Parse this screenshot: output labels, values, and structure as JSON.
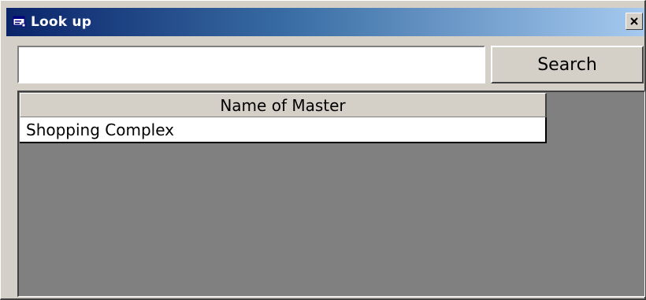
{
  "window": {
    "title": "Look up",
    "title_icon": "window-app-icon",
    "close_label": "×"
  },
  "search": {
    "value": "",
    "placeholder": "",
    "button_label": "Search"
  },
  "grid": {
    "columns": [
      "Name of Master"
    ],
    "rows": [
      [
        "Shopping Complex"
      ]
    ]
  },
  "colors": {
    "titlebar_start": "#0a246a",
    "titlebar_end": "#a6caf0",
    "face": "#d4d0c8",
    "grid_background": "#808080"
  }
}
